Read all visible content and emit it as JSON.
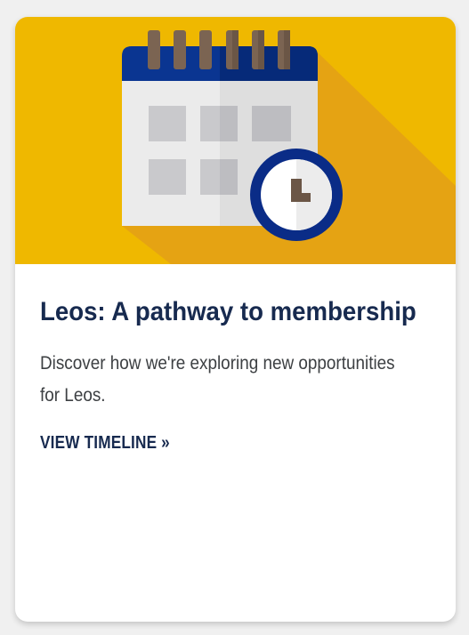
{
  "card": {
    "title": "Leos: A pathway to membership",
    "description": "Discover how we're exploring new opportunities for Leos.",
    "cta_label": "VIEW TIMELINE »"
  },
  "colors": {
    "hero_background": "#efb800",
    "hero_shadow": "#e5a313",
    "title": "#172a4f",
    "description": "#3d4043",
    "calendar_header": "#0a3591",
    "calendar_rings": "#7b6452",
    "clock_ring": "#0a2c87"
  },
  "icons": {
    "hero": "calendar-with-clock-icon"
  }
}
